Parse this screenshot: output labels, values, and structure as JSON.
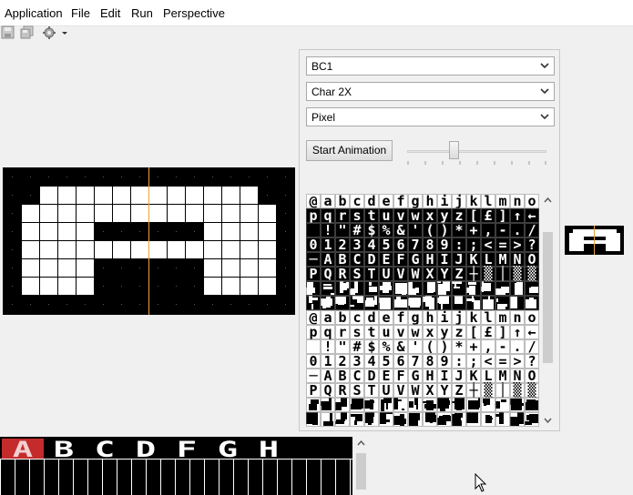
{
  "menubar": {
    "items": [
      {
        "label": "Application"
      },
      {
        "label": "File"
      },
      {
        "label": "Edit"
      },
      {
        "label": "Run"
      },
      {
        "label": "Perspective"
      }
    ]
  },
  "toolbar": {
    "icons": [
      "save-icon",
      "save-all-icon",
      "run-config-icon",
      "dropdown-arrow-icon"
    ]
  },
  "controls": {
    "platform_select": {
      "value": "BC1"
    },
    "mode_select": {
      "value": "Char 2X"
    },
    "draw_mode_select": {
      "value": "Pixel"
    },
    "animation_button": {
      "label": "Start Animation"
    },
    "speed_slider": {
      "level": 0.35
    }
  },
  "colors": {
    "accent_line": "#e8a33d",
    "selected_char": "#c42b2b",
    "ink": "#000000",
    "paper": "#ffffff"
  },
  "charset": {
    "rows": [
      "@abcdefghijklmno",
      "pqrstuvwxyz[£]↑←",
      " !\"#$%&'()*+,-./",
      "0123456789:;<=>?",
      "─ABCDEFGHIJKLMNO",
      "PQRSTUVWXYZ┼▒│▒▒"
    ]
  },
  "strip": {
    "selected_index": 0
  }
}
